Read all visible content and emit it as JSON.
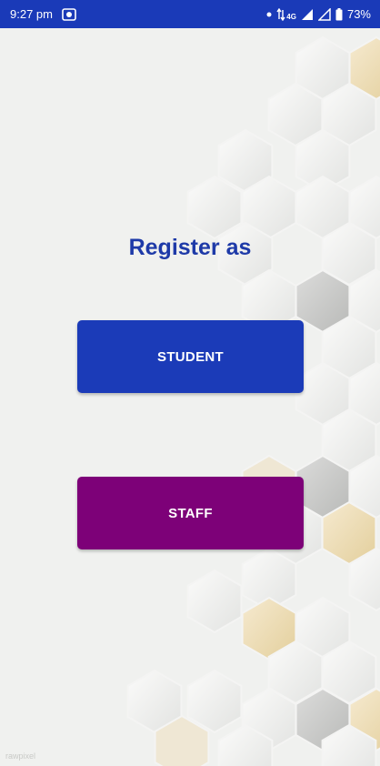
{
  "status_bar": {
    "time": "9:27 pm",
    "network_label": "4G",
    "battery": "73%"
  },
  "main": {
    "title": "Register as",
    "student_label": "STUDENT",
    "staff_label": "STAFF"
  },
  "watermark": "rawpixel",
  "colors": {
    "status_bar_bg": "#1a3ab8",
    "title": "#1e3aa8",
    "student_button": "#1b3bb8",
    "staff_button": "#7d0178",
    "background": "#f0f1ef"
  },
  "icons": [
    "screen-record-icon",
    "notification-dot-icon",
    "data-arrows-icon",
    "signal-icon",
    "battery-icon"
  ]
}
